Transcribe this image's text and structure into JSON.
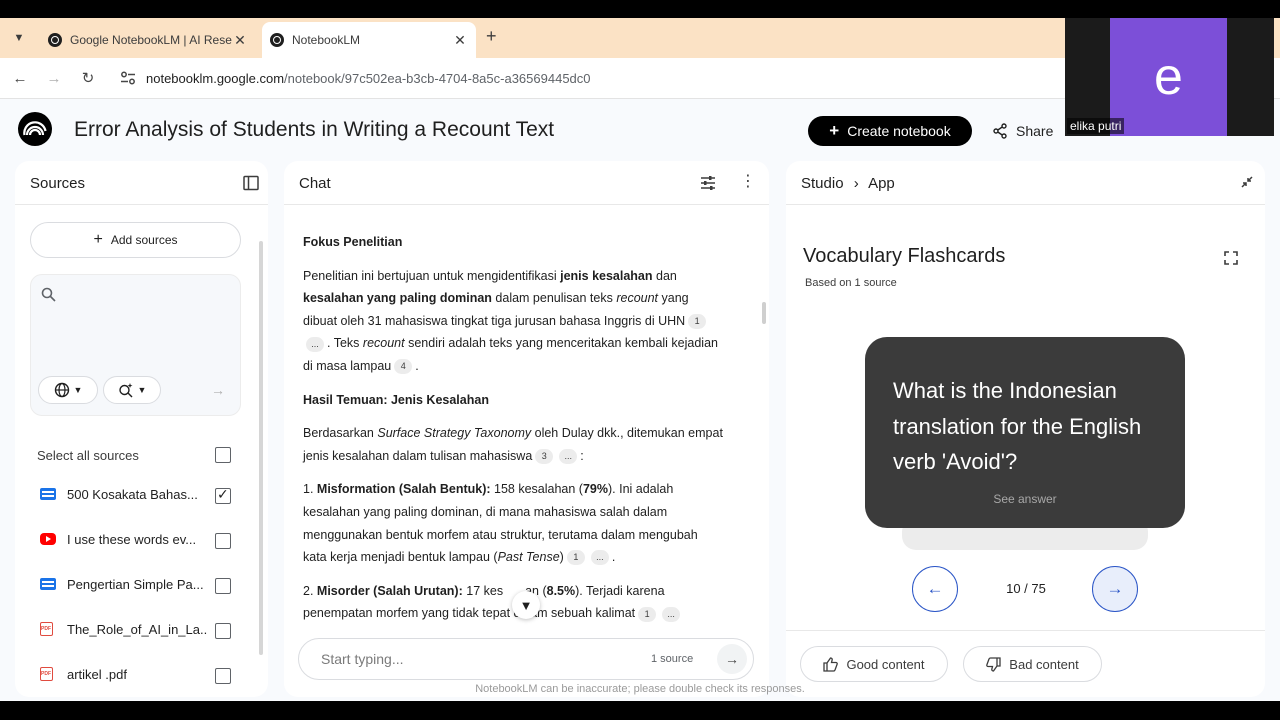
{
  "browser": {
    "tabs": [
      {
        "label": "Google NotebookLM | AI Rese"
      },
      {
        "label": "NotebookLM"
      }
    ],
    "url_host": "notebooklm.google.com",
    "url_path": "/notebook/97c502ea-b3cb-4704-8a5c-a36569445dc0"
  },
  "header": {
    "title": "Error Analysis of Students in Writing a Recount Text",
    "create_label": "Create notebook",
    "share_label": "Share"
  },
  "webcam": {
    "initial": "e",
    "name": "elika putri",
    "tile_color": "#7c4fd8"
  },
  "sources": {
    "title": "Sources",
    "add_label": "Add sources",
    "select_all": "Select all sources",
    "items": [
      {
        "label": "500 Kosakata Bahas...",
        "type": "doc",
        "checked": true
      },
      {
        "label": "I use these words ev...",
        "type": "youtube",
        "checked": false
      },
      {
        "label": "Pengertian Simple Pa...",
        "type": "doc",
        "checked": false
      },
      {
        "label": "The_Role_of_AI_in_La...",
        "type": "pdf",
        "checked": false
      },
      {
        "label": "artikel .pdf",
        "type": "pdf",
        "checked": false
      }
    ]
  },
  "chat": {
    "title": "Chat",
    "placeholder": "Start typing...",
    "source_count": "1 source",
    "heading1": "Fokus Penelitian",
    "p1": {
      "a": "Penelitian ini bertujuan untuk mengidentifikasi ",
      "b": "jenis kesalahan",
      "c": " dan ",
      "d": "kesalahan yang paling dominan",
      "e": " dalam penulisan teks ",
      "f": "recount",
      "g": " yang dibuat oleh 31 mahasiswa tingkat tiga jurusan bahasa Inggris di UHN",
      "cite1": "1",
      "cite2": "...",
      "h": ". Teks ",
      "i": "recount",
      "j": " sendiri adalah teks yang menceritakan kembali kejadian di masa lampau",
      "cite3": "4",
      "k": "."
    },
    "heading2": "Hasil Temuan: Jenis Kesalahan",
    "p2": {
      "a": "Berdasarkan ",
      "b": "Surface Strategy Taxonomy",
      "c": " oleh Dulay dkk., ditemukan empat jenis kesalahan dalam tulisan mahasiswa",
      "cite1": "3",
      "cite2": "...",
      "d": ":"
    },
    "p3": {
      "a": "1. ",
      "b": "Misformation (Salah Bentuk):",
      "c": " 158 kesalahan (",
      "d": "79%",
      "e": "). Ini adalah kesalahan yang paling dominan, di mana mahasiswa salah dalam menggunakan bentuk morfem atau struktur, terutama dalam mengubah kata kerja menjadi bentuk lampau (",
      "f": "Past Tense",
      "g": ")",
      "cite1": "1",
      "cite2": "...",
      "h": "."
    },
    "p4": {
      "a": "2. ",
      "b": "Misorder (Salah Urutan):",
      "c": " 17 kes",
      "c2": "an (",
      "d": "8.5%",
      "e": "). Terjadi karena penempatan morfem yang tidak tepat dalam sebuah kalimat",
      "cite1": "1",
      "cite2": "..."
    }
  },
  "studio": {
    "crumb_root": "Studio",
    "crumb_leaf": "App",
    "title": "Vocabulary Flashcards",
    "based_on": "Based on 1 source",
    "question": "What is the Indonesian translation for the English verb 'Avoid'?",
    "see_answer": "See answer",
    "counter": "10 / 75",
    "good_label": "Good content",
    "bad_label": "Bad content"
  },
  "disclaimer": "NotebookLM can be inaccurate; please double check its responses.",
  "colors": {
    "accent": "#2b56c7",
    "card": "#3b3b3b",
    "tab_strip": "#fbe2c5"
  }
}
